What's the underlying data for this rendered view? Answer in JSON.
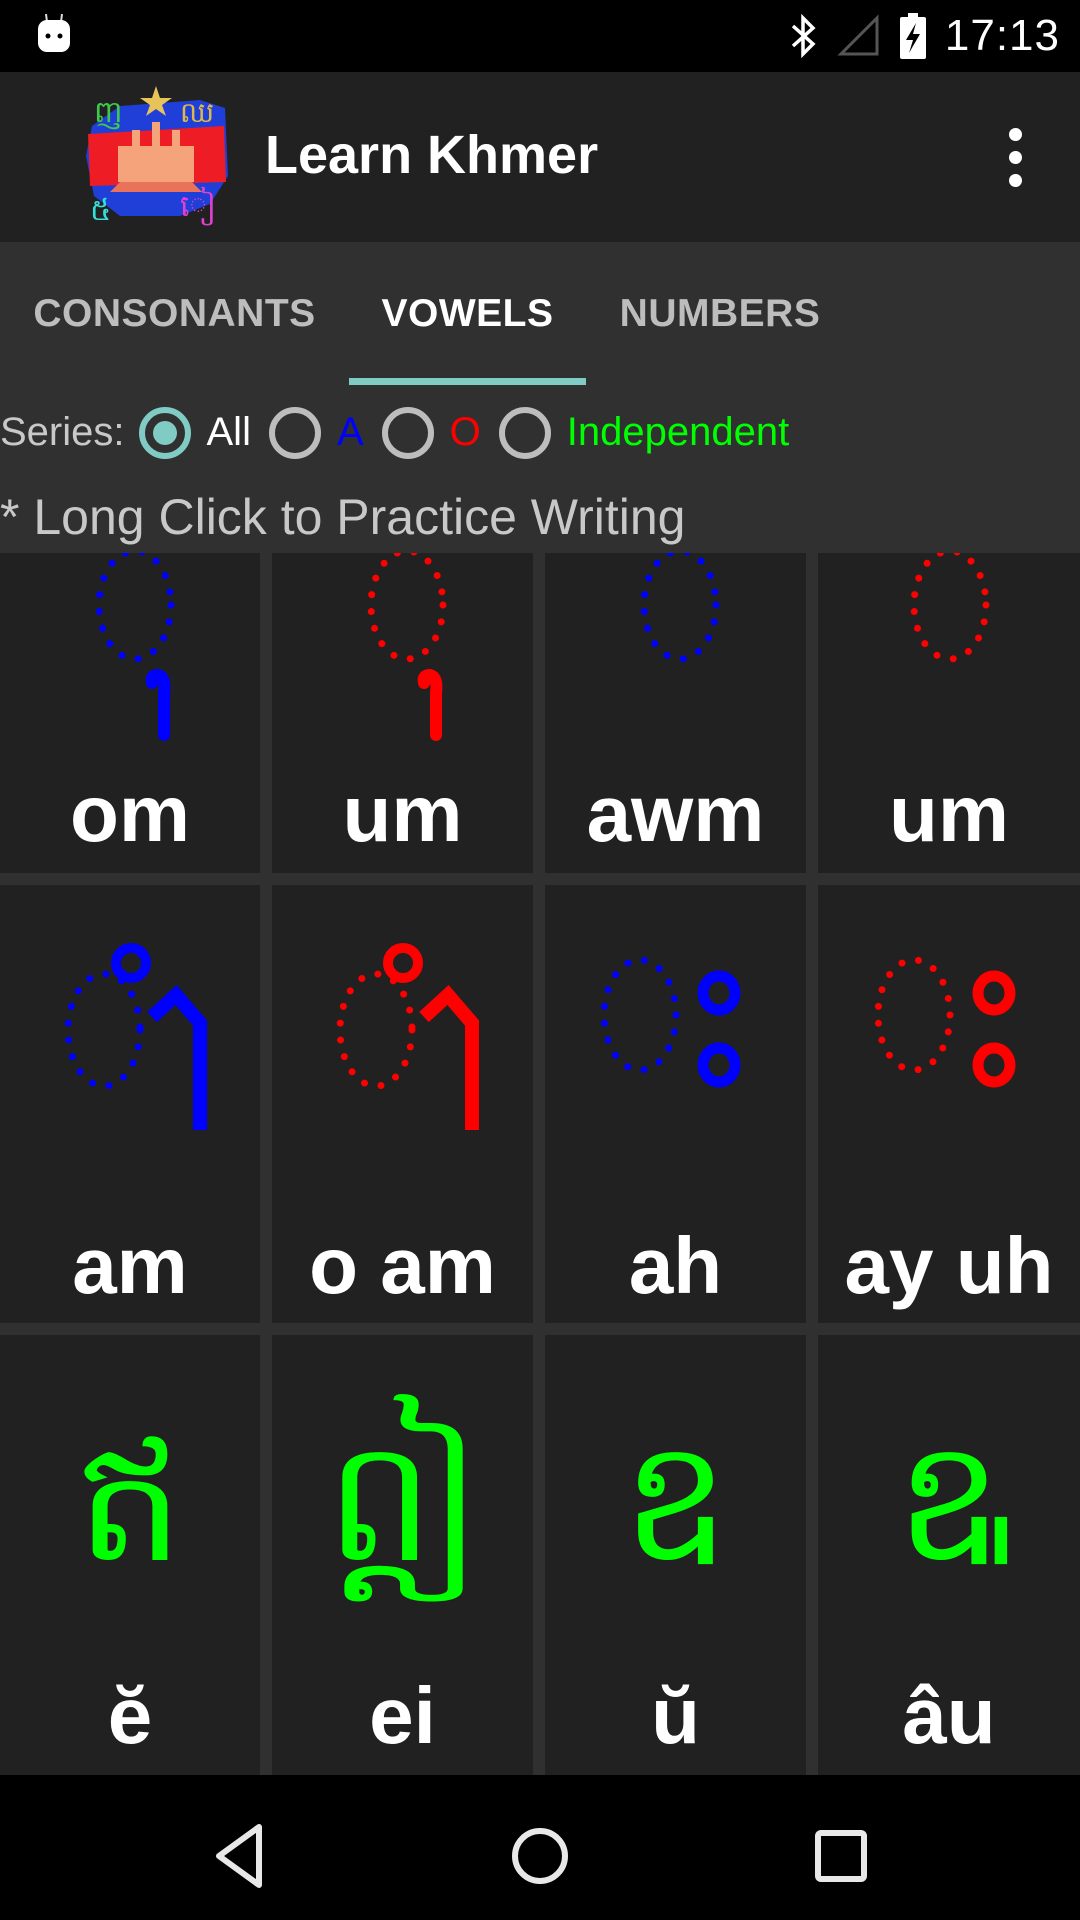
{
  "status_bar": {
    "time": "17:13",
    "icons": [
      "android-debug-icon",
      "bluetooth-icon",
      "signal-icon",
      "battery-charging-icon"
    ]
  },
  "toolbar": {
    "title": "Learn Khmer",
    "logo": "cambodia-flag-logo",
    "menu_icon": "overflow-menu-icon"
  },
  "tabs": [
    {
      "label": "CONSONANTS",
      "active": false
    },
    {
      "label": "VOWELS",
      "active": true
    },
    {
      "label": "NUMBERS",
      "active": false
    }
  ],
  "series": {
    "label": "Series:",
    "options": [
      {
        "label": "All",
        "color": "#ffffff",
        "checked": true
      },
      {
        "label": "A",
        "color": "#0000ff",
        "checked": false
      },
      {
        "label": "O",
        "color": "#ff0000",
        "checked": false
      },
      {
        "label": "Independent",
        "color": "#00ff00",
        "checked": false
      }
    ]
  },
  "hint": "* Long Click to Practice Writing",
  "colors": {
    "a_series": "#0000ff",
    "o_series": "#ff0000",
    "independent": "#00ff00",
    "accent": "#80cbc4"
  },
  "vowels": [
    {
      "roman": "om",
      "series": "A",
      "glyph": "ុំ"
    },
    {
      "roman": "um",
      "series": "O",
      "glyph": "ុំ"
    },
    {
      "roman": "awm",
      "series": "A",
      "glyph": "ំ"
    },
    {
      "roman": "um",
      "series": "O",
      "glyph": "ំ"
    },
    {
      "roman": "am",
      "series": "A",
      "glyph": "ាំ"
    },
    {
      "roman": "o am",
      "series": "O",
      "glyph": "ាំ"
    },
    {
      "roman": "ah",
      "series": "A",
      "glyph": "ះ"
    },
    {
      "roman": "ay uh",
      "series": "O",
      "glyph": "ះ"
    },
    {
      "roman": "ĕ",
      "series": "Independent",
      "glyph": "ឥ"
    },
    {
      "roman": "ei",
      "series": "Independent",
      "glyph": "ឦ"
    },
    {
      "roman": "ŭ",
      "series": "Independent",
      "glyph": "ឧ"
    },
    {
      "roman": "âu",
      "series": "Independent",
      "glyph": "ឩ"
    }
  ],
  "nav_bar": {
    "back": "back-icon",
    "home": "home-icon",
    "recents": "recents-icon"
  }
}
